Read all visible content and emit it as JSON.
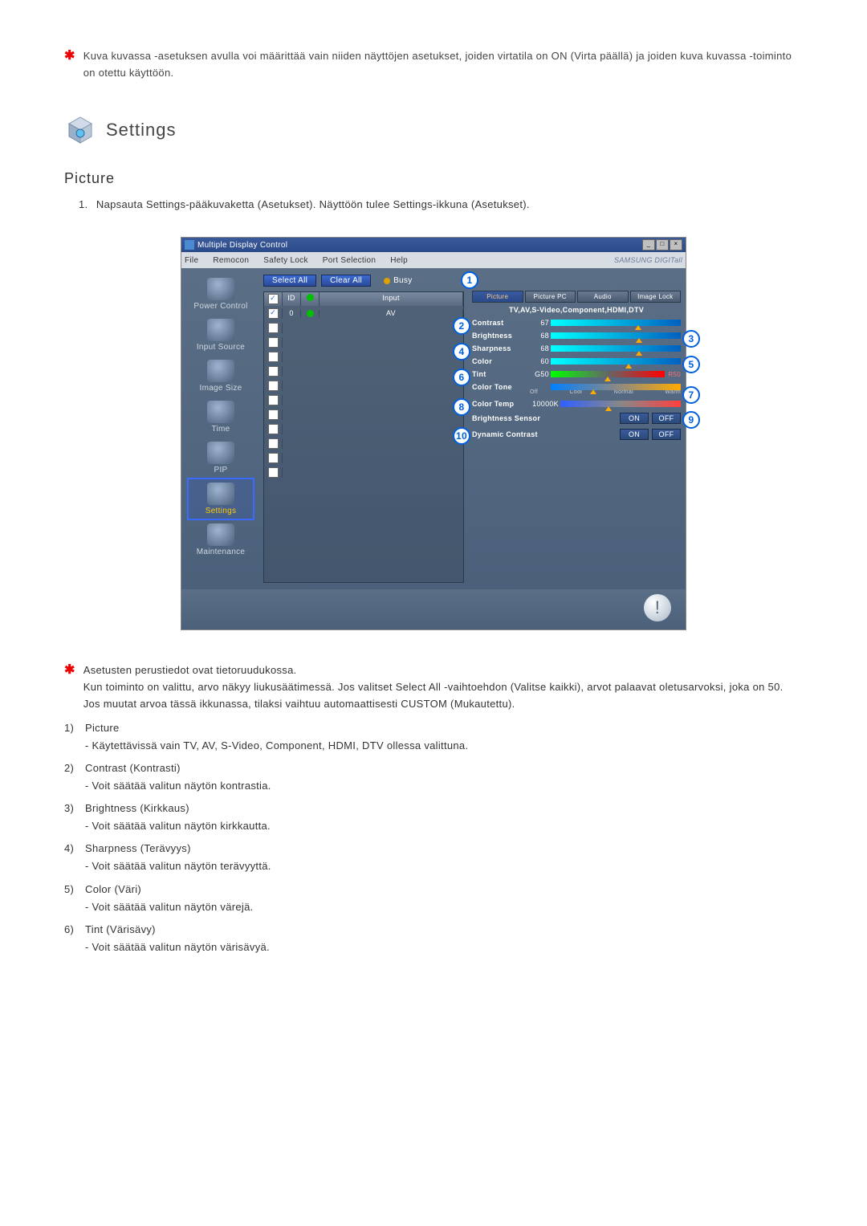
{
  "top_note": "Kuva kuvassa -asetuksen avulla voi määrittää vain niiden näyttöjen asetukset, joiden virtatila on ON (Virta päällä) ja joiden kuva kuvassa -toiminto on otettu käyttöön.",
  "settings_heading": "Settings",
  "section_picture": "Picture",
  "picture_intro_num": "1.",
  "picture_intro": "Napsauta Settings-pääkuvaketta (Asetukset). Näyttöön tulee Settings-ikkuna (Asetukset).",
  "window": {
    "title": "Multiple Display Control",
    "menus": [
      "File",
      "Remocon",
      "Safety Lock",
      "Port Selection",
      "Help"
    ],
    "brand": "SAMSUNG DIGITall",
    "buttons": {
      "select_all": "Select All",
      "clear_all": "Clear All",
      "busy": "Busy"
    },
    "sidebar": [
      {
        "label": "Power Control"
      },
      {
        "label": "Input Source"
      },
      {
        "label": "Image Size"
      },
      {
        "label": "Time"
      },
      {
        "label": "PIP"
      },
      {
        "label": "Settings",
        "selected": true
      },
      {
        "label": "Maintenance"
      }
    ],
    "grid": {
      "headers": {
        "id": "ID",
        "input": "Input"
      },
      "row0": {
        "id": "0",
        "input": "AV",
        "checked": true
      }
    },
    "rp": {
      "tabs": [
        "Picture",
        "Picture PC",
        "Audio",
        "Image Lock"
      ],
      "title_row": "TV,AV,S-Video,Component,HDMI,DTV",
      "contrast": "Contrast",
      "contrast_v": "67",
      "brightness": "Brightness",
      "brightness_v": "68",
      "sharpness": "Sharpness",
      "sharpness_v": "68",
      "color": "Color",
      "color_v": "60",
      "tint": "Tint",
      "tint_v": "G50",
      "tint_r": "R50",
      "color_tone": "Color Tone",
      "tone_labels": [
        "Off",
        "Cool",
        "Normal",
        "Warm"
      ],
      "color_temp": "Color Temp",
      "color_temp_v": "10000K",
      "b_sensor": "Brightness Sensor",
      "d_contrast": "Dynamic Contrast",
      "on": "ON",
      "off": "OFF"
    }
  },
  "note2_a": "Asetusten perustiedot ovat tietoruudukossa.",
  "note2_b": "Kun toiminto on valittu, arvo näkyy liukusäätimessä. Jos valitset Select All -vaihtoehdon (Valitse kaikki), arvot palaavat oletusarvoksi, joka on 50. Jos muutat arvoa tässä ikkunassa, tilaksi vaihtuu automaattisesti CUSTOM (Mukautettu).",
  "items": [
    {
      "n": "1)",
      "title": "Picture",
      "desc": "- Käytettävissä vain TV, AV, S-Video, Component, HDMI, DTV ollessa valittuna."
    },
    {
      "n": "2)",
      "title": "Contrast (Kontrasti)",
      "desc": "- Voit säätää valitun näytön kontrastia."
    },
    {
      "n": "3)",
      "title": "Brightness (Kirkkaus)",
      "desc": "- Voit säätää valitun näytön kirkkautta."
    },
    {
      "n": "4)",
      "title": "Sharpness (Terävyys)",
      "desc": "- Voit säätää valitun näytön terävyyttä."
    },
    {
      "n": "5)",
      "title": "Color (Väri)",
      "desc": "- Voit säätää valitun näytön värejä."
    },
    {
      "n": "6)",
      "title": "Tint (Värisävy)",
      "desc": "- Voit säätää valitun näytön värisävyä."
    }
  ]
}
